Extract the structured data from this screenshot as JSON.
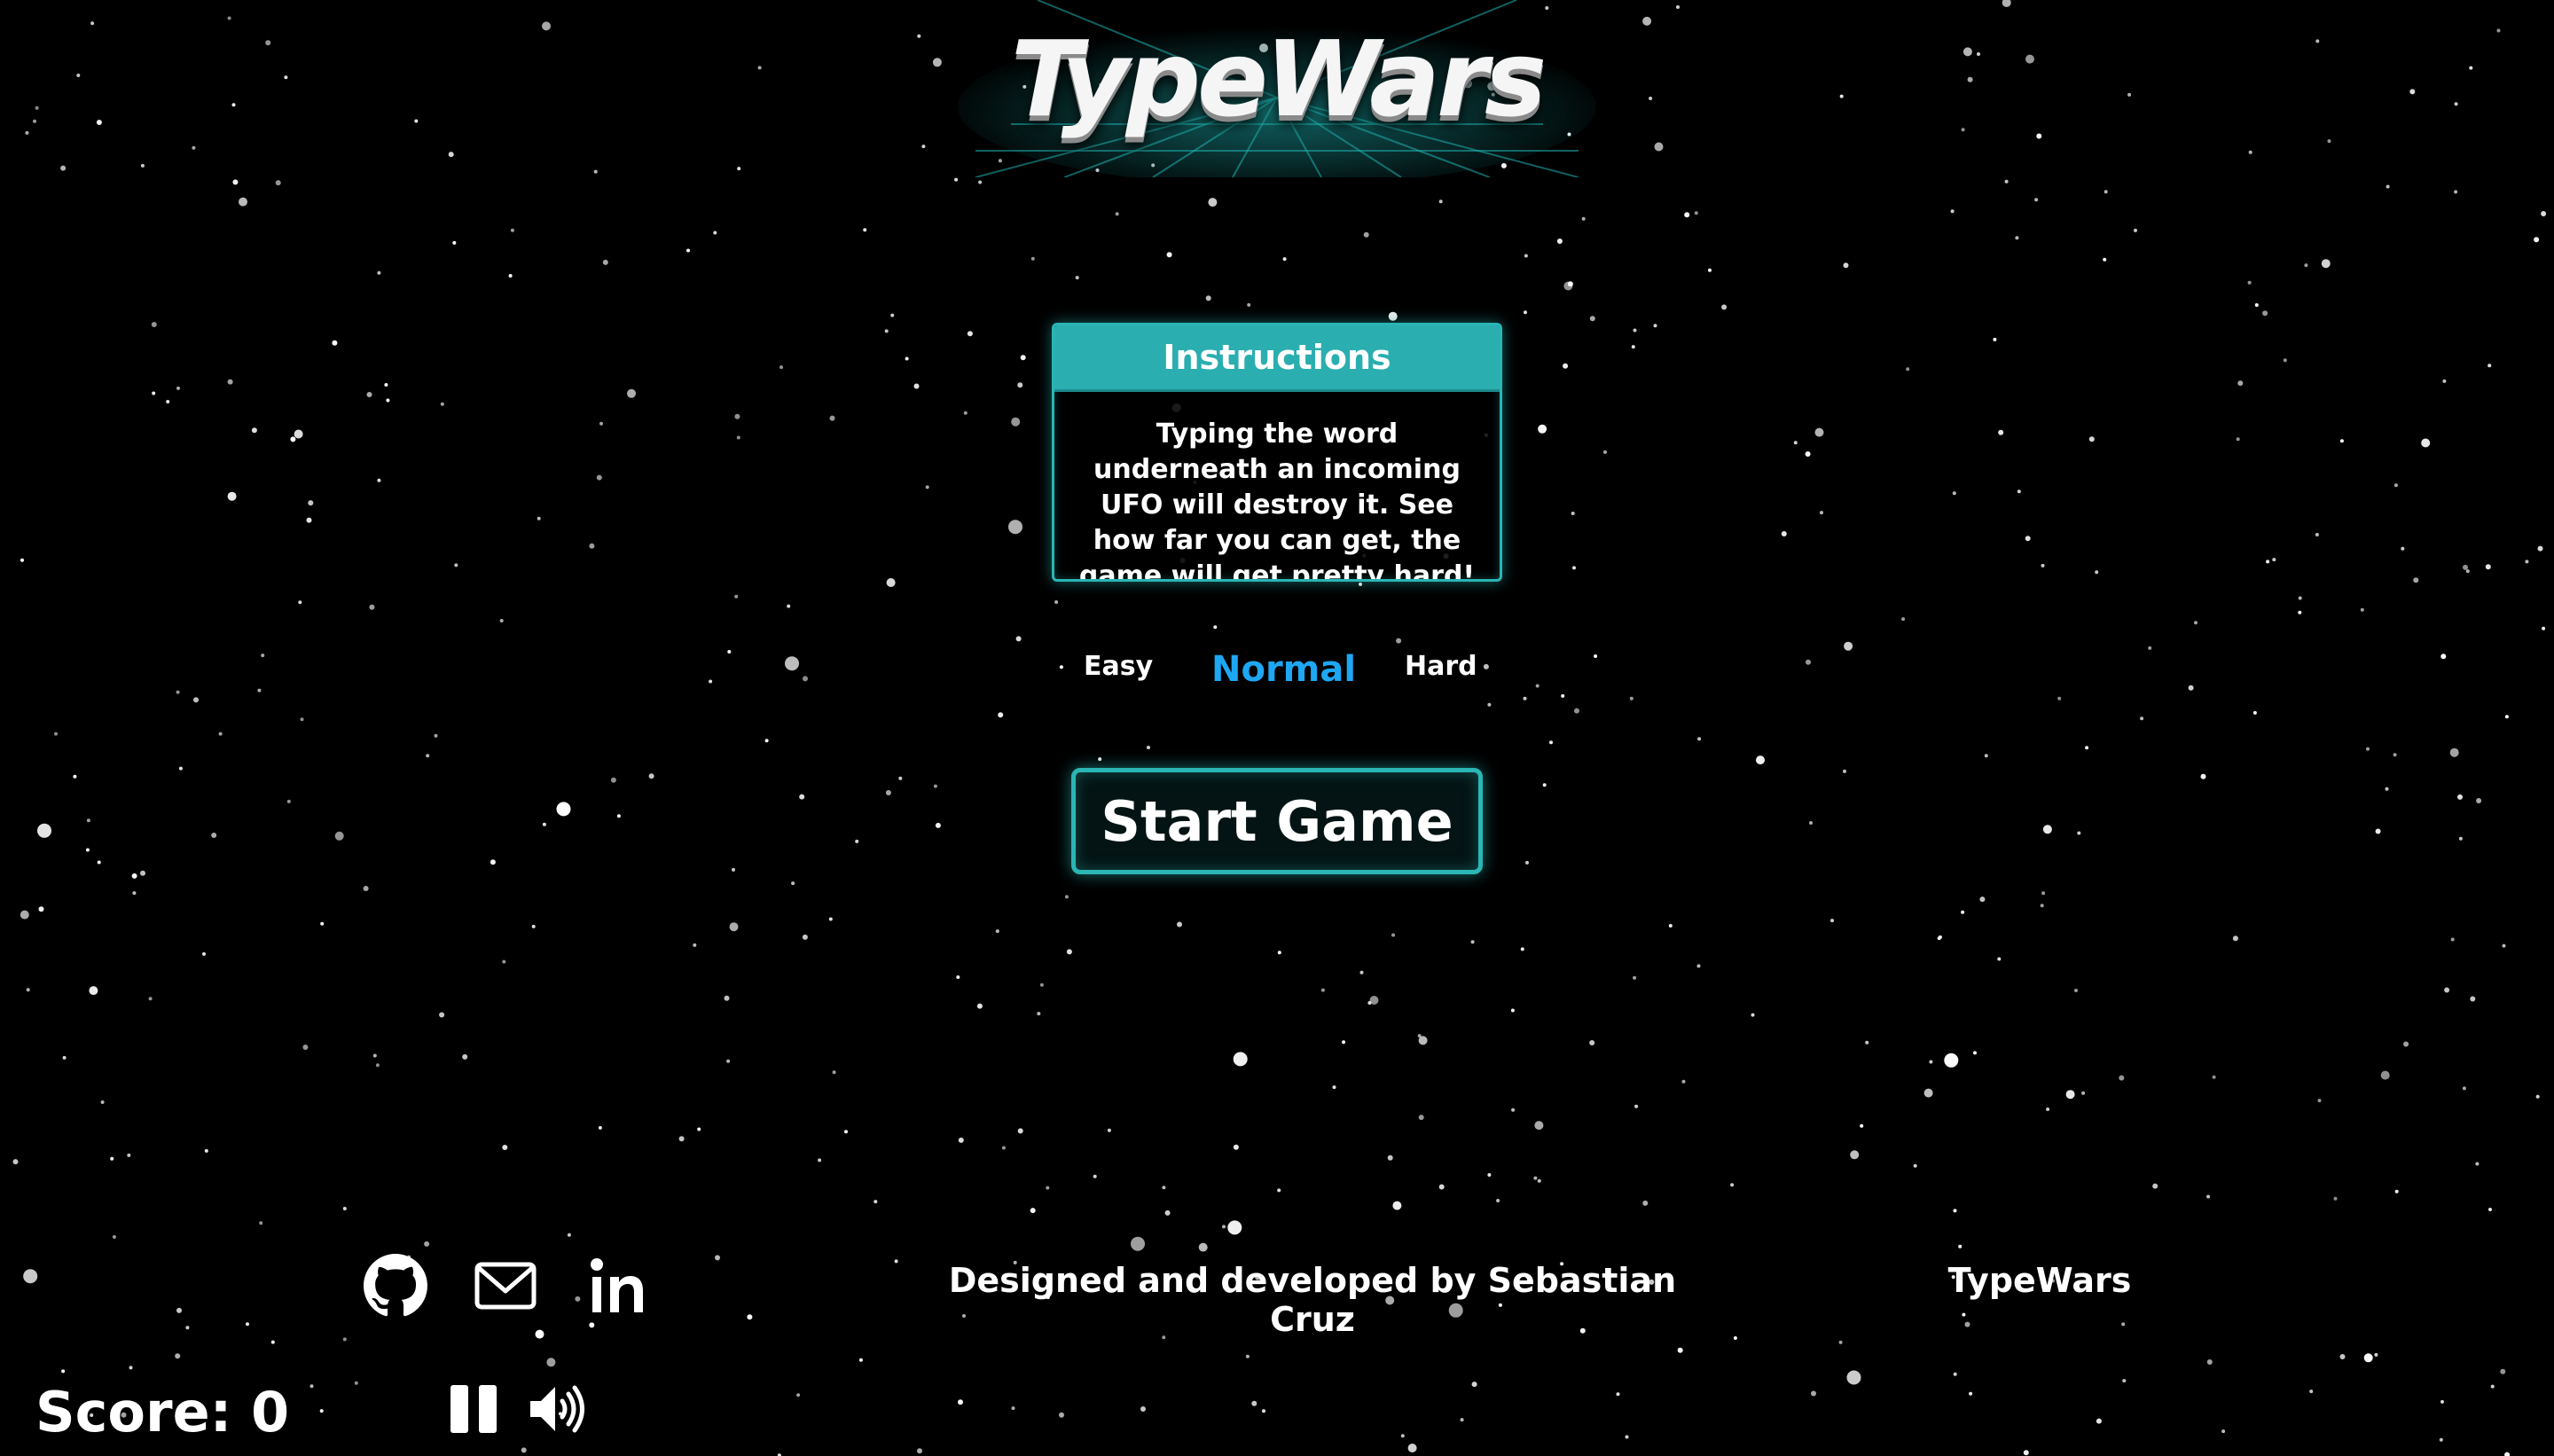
{
  "app": {
    "title": "TypeWars"
  },
  "instructions": {
    "heading": "Instructions",
    "body": "Typing the word underneath an incoming UFO will destroy it. See how far you can get, the game will get pretty hard!"
  },
  "difficulty": {
    "options": [
      "Easy",
      "Normal",
      "Hard"
    ],
    "selected": "Normal"
  },
  "start_button": {
    "label": "Start Game"
  },
  "footer": {
    "credits": "Designed and developed by Sebastian Cruz",
    "brand": "TypeWars",
    "icons": [
      "github-icon",
      "mail-icon",
      "linkedin-icon"
    ]
  },
  "hud": {
    "score_label": "Score:",
    "score_value": "0",
    "icons": [
      "pause-icon",
      "volume-icon"
    ]
  },
  "colors": {
    "background": "#000000",
    "accent_teal": "#2aaeb0",
    "selected_difficulty": "#1ea7f2",
    "text": "#ffffff"
  }
}
